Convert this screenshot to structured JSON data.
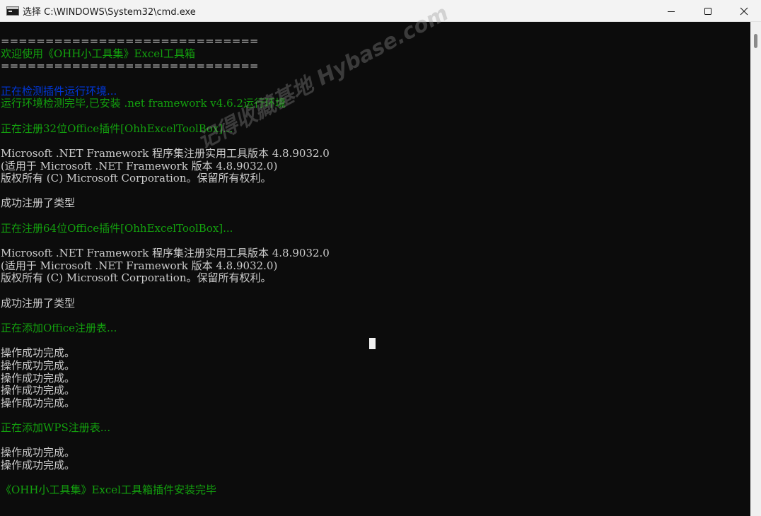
{
  "window": {
    "title": "选择 C:\\WINDOWS\\System32\\cmd.exe",
    "icon": "cmd-icon",
    "controls": [
      "minimize-icon",
      "maximize-icon",
      "close-icon"
    ]
  },
  "colors": {
    "background": "#0c0c0c",
    "default_text": "#cccccc",
    "green": "#13a10e",
    "blue": "#0037da",
    "title_bar": "#f3f3f3",
    "cursor": "#f2f2f2"
  },
  "console": {
    "lines": [
      {
        "text": "=============================",
        "color": "#cccccc"
      },
      {
        "text": "欢迎使用《OHH小工具集》Excel工具箱",
        "color": "#13a10e"
      },
      {
        "text": "=============================",
        "color": "#cccccc"
      },
      {
        "text": "",
        "color": "#cccccc"
      },
      {
        "text": "正在检测插件运行环境...",
        "color": "#0037da"
      },
      {
        "text": "运行环境检测完毕,已安装 .net framework v4.6.2运行环境",
        "color": "#13a10e"
      },
      {
        "text": "",
        "color": "#cccccc"
      },
      {
        "text": "正在注册32位Office插件[OhhExcelToolBox]...",
        "color": "#13a10e"
      },
      {
        "text": "",
        "color": "#cccccc"
      },
      {
        "text": "Microsoft .NET Framework 程序集注册实用工具版本 4.8.9032.0",
        "color": "#cccccc"
      },
      {
        "text": "(适用于 Microsoft .NET Framework 版本 4.8.9032.0)",
        "color": "#cccccc"
      },
      {
        "text": "版权所有 (C) Microsoft Corporation。保留所有权利。",
        "color": "#cccccc"
      },
      {
        "text": "",
        "color": "#cccccc"
      },
      {
        "text": "成功注册了类型",
        "color": "#cccccc"
      },
      {
        "text": "",
        "color": "#cccccc"
      },
      {
        "text": "正在注册64位Office插件[OhhExcelToolBox]...",
        "color": "#13a10e"
      },
      {
        "text": "",
        "color": "#cccccc"
      },
      {
        "text": "Microsoft .NET Framework 程序集注册实用工具版本 4.8.9032.0",
        "color": "#cccccc"
      },
      {
        "text": "(适用于 Microsoft .NET Framework 版本 4.8.9032.0)",
        "color": "#cccccc"
      },
      {
        "text": "版权所有 (C) Microsoft Corporation。保留所有权利。",
        "color": "#cccccc"
      },
      {
        "text": "",
        "color": "#cccccc"
      },
      {
        "text": "成功注册了类型",
        "color": "#cccccc"
      },
      {
        "text": "",
        "color": "#cccccc"
      },
      {
        "text": "正在添加Office注册表...",
        "color": "#13a10e"
      },
      {
        "text": "",
        "color": "#cccccc"
      },
      {
        "text": "操作成功完成。",
        "color": "#cccccc"
      },
      {
        "text": "操作成功完成。",
        "color": "#cccccc"
      },
      {
        "text": "操作成功完成。",
        "color": "#cccccc"
      },
      {
        "text": "操作成功完成。",
        "color": "#cccccc"
      },
      {
        "text": "操作成功完成。",
        "color": "#cccccc"
      },
      {
        "text": "",
        "color": "#cccccc"
      },
      {
        "text": "正在添加WPS注册表...",
        "color": "#13a10e"
      },
      {
        "text": "",
        "color": "#cccccc"
      },
      {
        "text": "操作成功完成。",
        "color": "#cccccc"
      },
      {
        "text": "操作成功完成。",
        "color": "#cccccc"
      },
      {
        "text": "",
        "color": "#cccccc"
      },
      {
        "text": "《OHH小工具集》Excel工具箱插件安装完毕",
        "color": "#13a10e"
      }
    ]
  },
  "watermark": {
    "text": "记得收藏基地 Hybase.com"
  }
}
